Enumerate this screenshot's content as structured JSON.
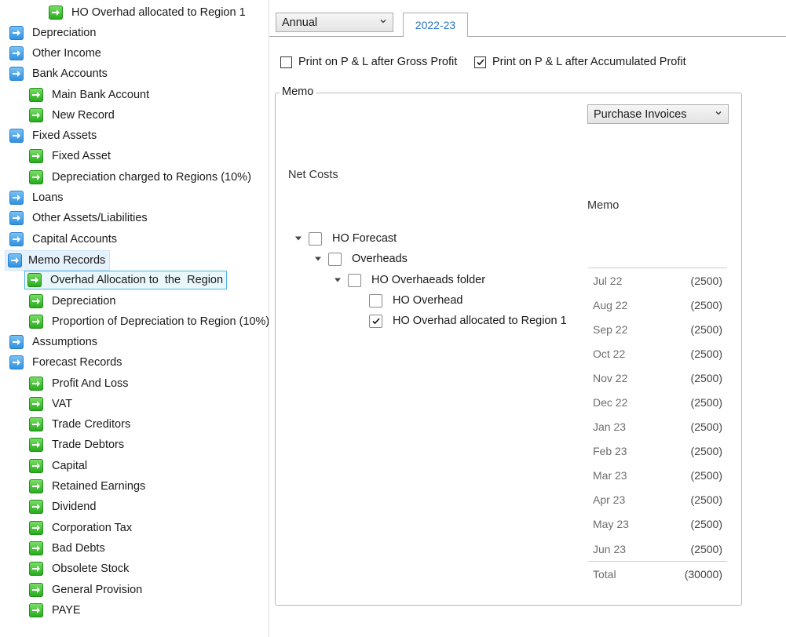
{
  "tree": {
    "items": [
      {
        "label": "HO Overhad allocated to Region 1",
        "icon": "green-arrow-icon"
      },
      {
        "label": "Depreciation",
        "icon": "blue-arrow-icon"
      },
      {
        "label": "Other Income",
        "icon": "blue-arrow-icon"
      },
      {
        "label": "Bank Accounts",
        "icon": "blue-arrow-icon"
      },
      {
        "label": "Main Bank Account",
        "icon": "green-arrow-icon"
      },
      {
        "label": "New Record",
        "icon": "green-arrow-icon"
      },
      {
        "label": "Fixed Assets",
        "icon": "blue-arrow-icon"
      },
      {
        "label": "Fixed Asset",
        "icon": "green-arrow-icon"
      },
      {
        "label": "Depreciation charged to Regions (10%)",
        "icon": "green-arrow-icon"
      },
      {
        "label": "Loans",
        "icon": "blue-arrow-icon"
      },
      {
        "label": "Other Assets/Liabilities",
        "icon": "blue-arrow-icon"
      },
      {
        "label": "Capital Accounts",
        "icon": "blue-arrow-icon"
      },
      {
        "label": "Memo Records",
        "icon": "blue-arrow-icon"
      },
      {
        "label": "Overhad Allocation to  the  Region",
        "icon": "green-arrow-icon"
      },
      {
        "label": "Depreciation",
        "icon": "green-arrow-icon"
      },
      {
        "label": "Proportion of Depreciation to Region (10%)",
        "icon": "green-arrow-icon"
      },
      {
        "label": "Assumptions",
        "icon": "blue-arrow-icon"
      },
      {
        "label": "Forecast Records",
        "icon": "blue-arrow-icon"
      },
      {
        "label": "Profit And Loss",
        "icon": "green-arrow-icon"
      },
      {
        "label": "VAT",
        "icon": "green-arrow-icon"
      },
      {
        "label": "Trade Creditors",
        "icon": "green-arrow-icon"
      },
      {
        "label": "Trade Debtors",
        "icon": "green-arrow-icon"
      },
      {
        "label": "Capital",
        "icon": "green-arrow-icon"
      },
      {
        "label": "Retained Earnings",
        "icon": "green-arrow-icon"
      },
      {
        "label": "Dividend",
        "icon": "green-arrow-icon"
      },
      {
        "label": "Corporation Tax",
        "icon": "green-arrow-icon"
      },
      {
        "label": "Bad Debts",
        "icon": "green-arrow-icon"
      },
      {
        "label": "Obsolete Stock",
        "icon": "green-arrow-icon"
      },
      {
        "label": "General Provision",
        "icon": "green-arrow-icon"
      },
      {
        "label": "PAYE",
        "icon": "green-arrow-icon"
      }
    ]
  },
  "period_select": {
    "value": "Annual"
  },
  "tab": {
    "label": "2022-23"
  },
  "options": {
    "gross_profit": {
      "label": "Print on P & L after Gross Profit",
      "checked": false
    },
    "accumulated_profit": {
      "label": "Print on P & L after Accumulated Profit",
      "checked": true
    }
  },
  "memo": {
    "legend": "Memo",
    "source_select": "Purchase Invoices",
    "net_costs_label": "Net Costs",
    "column_header": "Memo",
    "tree": [
      {
        "label": "HO Forecast",
        "expanded": true,
        "checked": false
      },
      {
        "label": "Overheads",
        "expanded": true,
        "checked": false
      },
      {
        "label": "HO Overhaeads folder",
        "expanded": true,
        "checked": false
      },
      {
        "label": "HO Overhead",
        "checked": false
      },
      {
        "label": "HO Overhad allocated to Region 1",
        "checked": true
      }
    ],
    "rows": [
      {
        "month": "Jul 22",
        "value": "(2500)"
      },
      {
        "month": "Aug 22",
        "value": "(2500)"
      },
      {
        "month": "Sep 22",
        "value": "(2500)"
      },
      {
        "month": "Oct 22",
        "value": "(2500)"
      },
      {
        "month": "Nov 22",
        "value": "(2500)"
      },
      {
        "month": "Dec 22",
        "value": "(2500)"
      },
      {
        "month": "Jan 23",
        "value": "(2500)"
      },
      {
        "month": "Feb 23",
        "value": "(2500)"
      },
      {
        "month": "Mar 23",
        "value": "(2500)"
      },
      {
        "month": "Apr 23",
        "value": "(2500)"
      },
      {
        "month": "May 23",
        "value": "(2500)"
      },
      {
        "month": "Jun 23",
        "value": "(2500)"
      }
    ],
    "total": {
      "label": "Total",
      "value": "(30000)"
    }
  }
}
